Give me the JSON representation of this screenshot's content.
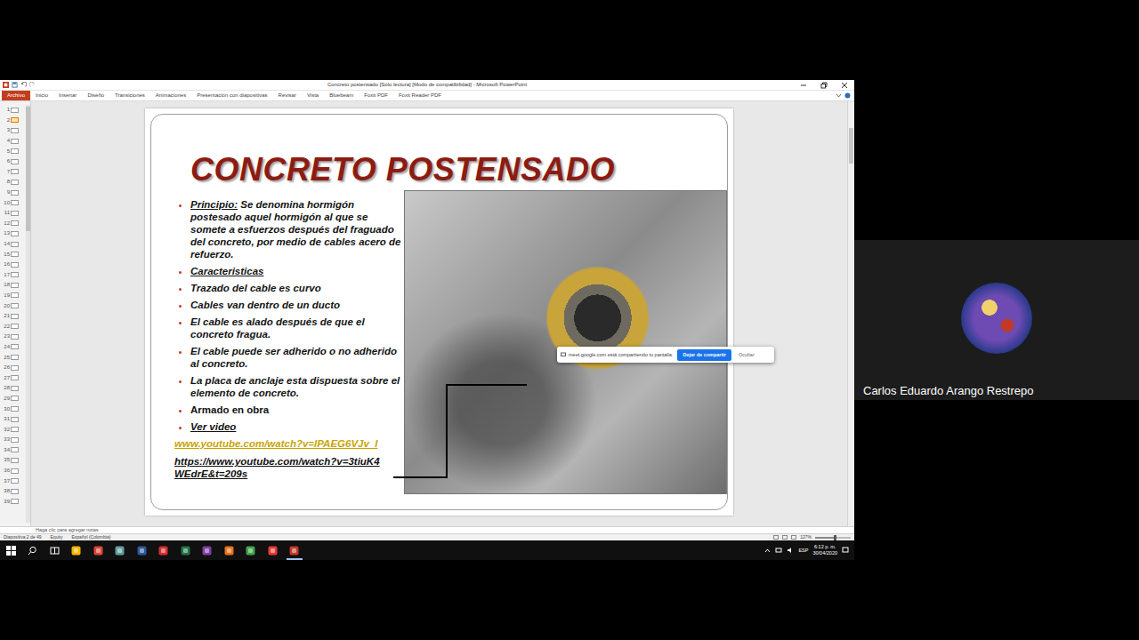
{
  "window": {
    "title": "Concreto postensado [Sólo lectura] [Modo de compatibilidad] - Microsoft PowerPoint"
  },
  "ribbon_tabs": [
    {
      "label": "Archivo",
      "selected": true
    },
    {
      "label": "Inicio",
      "selected": false
    },
    {
      "label": "Insertar",
      "selected": false
    },
    {
      "label": "Diseño",
      "selected": false
    },
    {
      "label": "Transiciones",
      "selected": false
    },
    {
      "label": "Animaciones",
      "selected": false
    },
    {
      "label": "Presentación con diapositivas",
      "selected": false
    },
    {
      "label": "Revisar",
      "selected": false
    },
    {
      "label": "Vista",
      "selected": false
    },
    {
      "label": "Bluebeam",
      "selected": false
    },
    {
      "label": "Foxit PDF",
      "selected": false
    },
    {
      "label": "Foxit Reader PDF",
      "selected": false
    }
  ],
  "thumbnails": [
    {
      "number": "1",
      "selected": false
    },
    {
      "number": "2",
      "selected": true
    },
    {
      "number": "3",
      "selected": false
    },
    {
      "number": "4",
      "selected": false
    },
    {
      "number": "5",
      "selected": false
    },
    {
      "number": "6",
      "selected": false
    },
    {
      "number": "7",
      "selected": false
    },
    {
      "number": "8",
      "selected": false
    },
    {
      "number": "9",
      "selected": false
    },
    {
      "number": "10",
      "selected": false
    },
    {
      "number": "11",
      "selected": false
    },
    {
      "number": "12",
      "selected": false
    },
    {
      "number": "13",
      "selected": false
    },
    {
      "number": "14",
      "selected": false
    },
    {
      "number": "15",
      "selected": false
    },
    {
      "number": "16",
      "selected": false
    },
    {
      "number": "17",
      "selected": false
    },
    {
      "number": "18",
      "selected": false
    },
    {
      "number": "19",
      "selected": false
    },
    {
      "number": "20",
      "selected": false
    },
    {
      "number": "21",
      "selected": false
    },
    {
      "number": "22",
      "selected": false
    },
    {
      "number": "23",
      "selected": false
    },
    {
      "number": "24",
      "selected": false
    },
    {
      "number": "25",
      "selected": false
    },
    {
      "number": "26",
      "selected": false
    },
    {
      "number": "27",
      "selected": false
    },
    {
      "number": "28",
      "selected": false
    },
    {
      "number": "29",
      "selected": false
    },
    {
      "number": "30",
      "selected": false
    },
    {
      "number": "31",
      "selected": false
    },
    {
      "number": "32",
      "selected": false
    },
    {
      "number": "33",
      "selected": false
    },
    {
      "number": "34",
      "selected": false
    },
    {
      "number": "35",
      "selected": false
    },
    {
      "number": "36",
      "selected": false
    },
    {
      "number": "37",
      "selected": false
    },
    {
      "number": "38",
      "selected": false
    },
    {
      "number": "39",
      "selected": false
    }
  ],
  "slide": {
    "title": "CONCRETO POSTENSADO",
    "bullets": [
      {
        "kind": "definition",
        "lead": "Principio:",
        "text": " Se denomina hormigón postesado aquel hormigón al que se somete a esfuerzos después del fraguado del concreto, por medio de cables acero de refuerzo."
      },
      {
        "kind": "heading",
        "lead": "Caracteristicas",
        "text": ""
      },
      {
        "kind": "point",
        "lead": "",
        "text": "Trazado del cable es curvo"
      },
      {
        "kind": "point",
        "lead": "",
        "text": "Cables van dentro de un ducto"
      },
      {
        "kind": "point",
        "lead": "",
        "text": "El cable es alado después de que el concreto fragua."
      },
      {
        "kind": "point",
        "lead": "",
        "text": "El cable puede ser adherido o no adherido al concreto."
      },
      {
        "kind": "point",
        "lead": "",
        "text": "La placa de anclaje esta dispuesta sobre el elemento de concreto."
      },
      {
        "kind": "plain",
        "lead": "",
        "text": "Armado en obra"
      },
      {
        "kind": "heading",
        "lead": "Ver video",
        "text": ""
      }
    ],
    "links": [
      {
        "text": "www.youtube.com/watch?v=lPAEG6VJv_I",
        "color": "#c9a400"
      },
      {
        "text": "https://www.youtube.com/watch?v=3tiuK4WEdrE&t=209s",
        "color": "#111111"
      }
    ]
  },
  "notes": {
    "placeholder": "Haga clic para agregar notas"
  },
  "status_bar": {
    "slide": "Diapositiva 2 de 49",
    "theme": "Equity",
    "language": "Español (Colombia)",
    "zoom": "127%",
    "zoom_level": 0.55
  },
  "share_banner": {
    "message": "meet.google.com está compartiendo tu pantalla.",
    "stop": "Dejar de compartir",
    "hide": "Ocultar"
  },
  "taskbar": {
    "apps": [
      {
        "color": "#f4b400",
        "selected": false
      },
      {
        "color": "#db4437",
        "selected": false
      },
      {
        "color": "#5f9ea0",
        "selected": false
      },
      {
        "color": "#2b579a",
        "selected": false
      },
      {
        "color": "#d32f2f",
        "selected": false
      },
      {
        "color": "#217346",
        "selected": false
      },
      {
        "color": "#7b3fa0",
        "selected": false
      },
      {
        "color": "#e8711a",
        "selected": false
      },
      {
        "color": "#3fa34d",
        "selected": false
      },
      {
        "color": "#e53935",
        "selected": false
      },
      {
        "color": "#c0392b",
        "selected": true
      }
    ],
    "language": "ESP",
    "time": "6:12 p. m.",
    "date": "30/04/2020"
  },
  "participant": {
    "name": "Carlos Eduardo Arango Restrepo"
  }
}
